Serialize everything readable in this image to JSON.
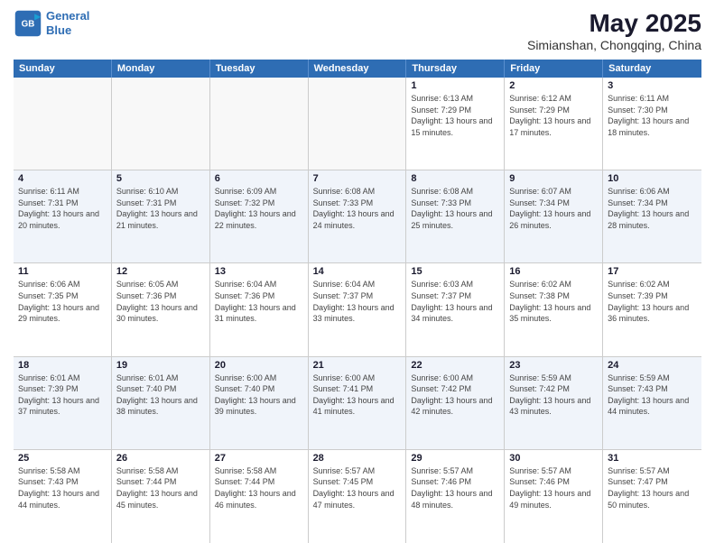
{
  "logo": {
    "line1": "General",
    "line2": "Blue"
  },
  "title": {
    "month_year": "May 2025",
    "location": "Simianshan, Chongqing, China"
  },
  "days_of_week": [
    "Sunday",
    "Monday",
    "Tuesday",
    "Wednesday",
    "Thursday",
    "Friday",
    "Saturday"
  ],
  "weeks": [
    [
      {
        "day": "",
        "info": ""
      },
      {
        "day": "",
        "info": ""
      },
      {
        "day": "",
        "info": ""
      },
      {
        "day": "",
        "info": ""
      },
      {
        "day": "1",
        "info": "Sunrise: 6:13 AM\nSunset: 7:29 PM\nDaylight: 13 hours and 15 minutes."
      },
      {
        "day": "2",
        "info": "Sunrise: 6:12 AM\nSunset: 7:29 PM\nDaylight: 13 hours and 17 minutes."
      },
      {
        "day": "3",
        "info": "Sunrise: 6:11 AM\nSunset: 7:30 PM\nDaylight: 13 hours and 18 minutes."
      }
    ],
    [
      {
        "day": "4",
        "info": "Sunrise: 6:11 AM\nSunset: 7:31 PM\nDaylight: 13 hours and 20 minutes."
      },
      {
        "day": "5",
        "info": "Sunrise: 6:10 AM\nSunset: 7:31 PM\nDaylight: 13 hours and 21 minutes."
      },
      {
        "day": "6",
        "info": "Sunrise: 6:09 AM\nSunset: 7:32 PM\nDaylight: 13 hours and 22 minutes."
      },
      {
        "day": "7",
        "info": "Sunrise: 6:08 AM\nSunset: 7:33 PM\nDaylight: 13 hours and 24 minutes."
      },
      {
        "day": "8",
        "info": "Sunrise: 6:08 AM\nSunset: 7:33 PM\nDaylight: 13 hours and 25 minutes."
      },
      {
        "day": "9",
        "info": "Sunrise: 6:07 AM\nSunset: 7:34 PM\nDaylight: 13 hours and 26 minutes."
      },
      {
        "day": "10",
        "info": "Sunrise: 6:06 AM\nSunset: 7:34 PM\nDaylight: 13 hours and 28 minutes."
      }
    ],
    [
      {
        "day": "11",
        "info": "Sunrise: 6:06 AM\nSunset: 7:35 PM\nDaylight: 13 hours and 29 minutes."
      },
      {
        "day": "12",
        "info": "Sunrise: 6:05 AM\nSunset: 7:36 PM\nDaylight: 13 hours and 30 minutes."
      },
      {
        "day": "13",
        "info": "Sunrise: 6:04 AM\nSunset: 7:36 PM\nDaylight: 13 hours and 31 minutes."
      },
      {
        "day": "14",
        "info": "Sunrise: 6:04 AM\nSunset: 7:37 PM\nDaylight: 13 hours and 33 minutes."
      },
      {
        "day": "15",
        "info": "Sunrise: 6:03 AM\nSunset: 7:37 PM\nDaylight: 13 hours and 34 minutes."
      },
      {
        "day": "16",
        "info": "Sunrise: 6:02 AM\nSunset: 7:38 PM\nDaylight: 13 hours and 35 minutes."
      },
      {
        "day": "17",
        "info": "Sunrise: 6:02 AM\nSunset: 7:39 PM\nDaylight: 13 hours and 36 minutes."
      }
    ],
    [
      {
        "day": "18",
        "info": "Sunrise: 6:01 AM\nSunset: 7:39 PM\nDaylight: 13 hours and 37 minutes."
      },
      {
        "day": "19",
        "info": "Sunrise: 6:01 AM\nSunset: 7:40 PM\nDaylight: 13 hours and 38 minutes."
      },
      {
        "day": "20",
        "info": "Sunrise: 6:00 AM\nSunset: 7:40 PM\nDaylight: 13 hours and 39 minutes."
      },
      {
        "day": "21",
        "info": "Sunrise: 6:00 AM\nSunset: 7:41 PM\nDaylight: 13 hours and 41 minutes."
      },
      {
        "day": "22",
        "info": "Sunrise: 6:00 AM\nSunset: 7:42 PM\nDaylight: 13 hours and 42 minutes."
      },
      {
        "day": "23",
        "info": "Sunrise: 5:59 AM\nSunset: 7:42 PM\nDaylight: 13 hours and 43 minutes."
      },
      {
        "day": "24",
        "info": "Sunrise: 5:59 AM\nSunset: 7:43 PM\nDaylight: 13 hours and 44 minutes."
      }
    ],
    [
      {
        "day": "25",
        "info": "Sunrise: 5:58 AM\nSunset: 7:43 PM\nDaylight: 13 hours and 44 minutes."
      },
      {
        "day": "26",
        "info": "Sunrise: 5:58 AM\nSunset: 7:44 PM\nDaylight: 13 hours and 45 minutes."
      },
      {
        "day": "27",
        "info": "Sunrise: 5:58 AM\nSunset: 7:44 PM\nDaylight: 13 hours and 46 minutes."
      },
      {
        "day": "28",
        "info": "Sunrise: 5:57 AM\nSunset: 7:45 PM\nDaylight: 13 hours and 47 minutes."
      },
      {
        "day": "29",
        "info": "Sunrise: 5:57 AM\nSunset: 7:46 PM\nDaylight: 13 hours and 48 minutes."
      },
      {
        "day": "30",
        "info": "Sunrise: 5:57 AM\nSunset: 7:46 PM\nDaylight: 13 hours and 49 minutes."
      },
      {
        "day": "31",
        "info": "Sunrise: 5:57 AM\nSunset: 7:47 PM\nDaylight: 13 hours and 50 minutes."
      }
    ]
  ]
}
